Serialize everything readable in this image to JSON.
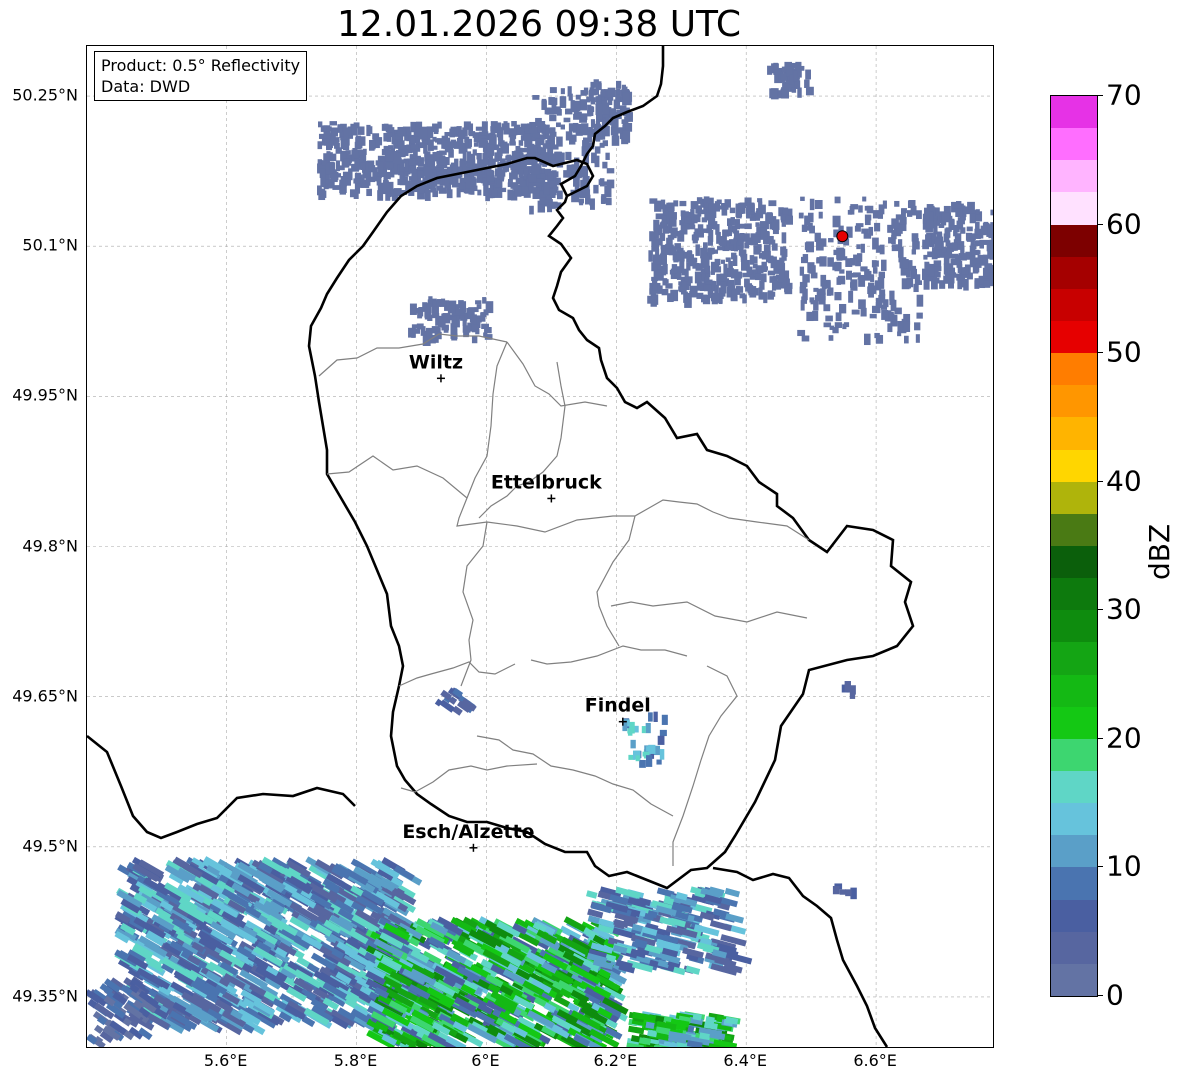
{
  "title": "12.01.2026 09:38 UTC",
  "info": {
    "product": "Product: 0.5° Reflectivity",
    "data": "Data: DWD"
  },
  "lat_ticks": [
    {
      "label": "50.25°N",
      "value": 50.25
    },
    {
      "label": "50.1°N",
      "value": 50.1
    },
    {
      "label": "49.95°N",
      "value": 49.95
    },
    {
      "label": "49.8°N",
      "value": 49.8
    },
    {
      "label": "49.65°N",
      "value": 49.65
    },
    {
      "label": "49.5°N",
      "value": 49.5
    },
    {
      "label": "49.35°N",
      "value": 49.35
    }
  ],
  "lon_ticks": [
    {
      "label": "5.6°E",
      "value": 5.6
    },
    {
      "label": "5.8°E",
      "value": 5.8
    },
    {
      "label": "6°E",
      "value": 6.0
    },
    {
      "label": "6.2°E",
      "value": 6.2
    },
    {
      "label": "6.4°E",
      "value": 6.4
    },
    {
      "label": "6.6°E",
      "value": 6.6
    }
  ],
  "extent": {
    "lon_min": 5.385,
    "lon_max": 6.78,
    "lat_min": 49.3,
    "lat_max": 50.3
  },
  "cities": [
    {
      "name": "Wiltz",
      "lon": 5.93,
      "lat": 49.968
    },
    {
      "name": "Ettelbruck",
      "lon": 6.1,
      "lat": 49.848
    },
    {
      "name": "Findel",
      "lon": 6.21,
      "lat": 49.625
    },
    {
      "name": "Esch/Alzette",
      "lon": 5.98,
      "lat": 49.499
    }
  ],
  "radar_site": {
    "lon": 6.548,
    "lat": 50.11,
    "color": "#e60000"
  },
  "colorbar": {
    "unit": "dBZ",
    "min": 0,
    "max": 70,
    "ticks": [
      "0",
      "10",
      "20",
      "30",
      "40",
      "50",
      "60",
      "70"
    ],
    "colors": [
      "#6373a4",
      "#5766a0",
      "#4a5fa1",
      "#4a74b0",
      "#5a9fc8",
      "#66c3dc",
      "#5fd6c6",
      "#3dd670",
      "#14c814",
      "#14b914",
      "#14a514",
      "#0e8c0e",
      "#0d7a0d",
      "#0b5f0b",
      "#4a7a14",
      "#afb40b",
      "#ffd600",
      "#ffb400",
      "#ff9600",
      "#ff7d00",
      "#e60000",
      "#c80000",
      "#a50000",
      "#7d0000",
      "#ffe1ff",
      "#ffb4ff",
      "#ff6eff",
      "#e632e6"
    ]
  },
  "chart_data": {
    "type": "heatmap",
    "title": "12.01.2026 09:38 UTC",
    "colorbar_label": "dBZ",
    "xlim": [
      5.385,
      6.78
    ],
    "ylim": [
      49.3,
      50.3
    ]
  }
}
